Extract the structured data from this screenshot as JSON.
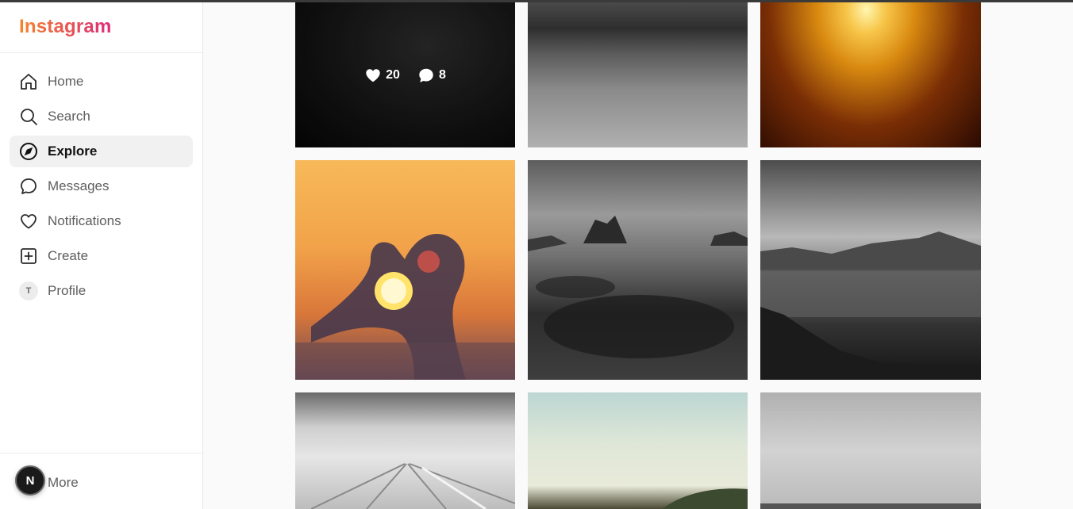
{
  "app": {
    "logo": "Instagram"
  },
  "nav": {
    "items": [
      {
        "label": "Home",
        "icon": "home-icon"
      },
      {
        "label": "Search",
        "icon": "search-icon"
      },
      {
        "label": "Explore",
        "icon": "compass-icon",
        "active": true
      },
      {
        "label": "Messages",
        "icon": "message-bubble-icon"
      },
      {
        "label": "Notifications",
        "icon": "heart-icon"
      },
      {
        "label": "Create",
        "icon": "plus-square-icon"
      },
      {
        "label": "Profile",
        "icon": "avatar",
        "avatar_letter": "T"
      }
    ],
    "more_label": "More"
  },
  "floating_badge": {
    "letter": "N"
  },
  "grid": {
    "hovered_post": {
      "likes": "20",
      "comments": "8"
    },
    "posts": [
      "dark-grass",
      "water-reflection",
      "golden-street",
      "heart-hands-sunset",
      "rocky-shore",
      "lake-mountains",
      "pier-clouds",
      "green-hill-sky",
      "grey-horizon"
    ]
  },
  "colors": {
    "logo_gradient_start": "#f58529",
    "logo_gradient_end": "#dd2a7b"
  }
}
